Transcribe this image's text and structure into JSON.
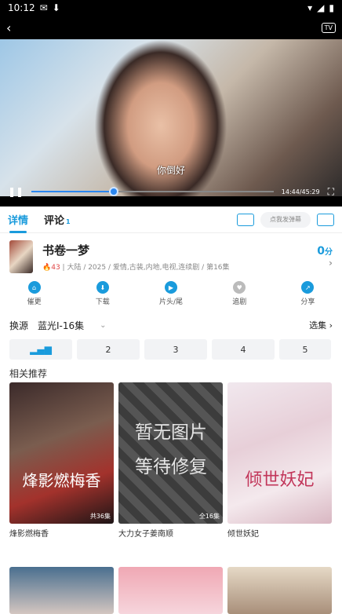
{
  "statusbar": {
    "time": "10:12"
  },
  "player": {
    "subtitle": "你倒好",
    "time_display": "14:44/45:29",
    "progress": 0.34
  },
  "tabs": [
    {
      "label": "详情"
    },
    {
      "label": "评论",
      "count": "1"
    }
  ],
  "danmu": {
    "placeholder": "点我发弹幕"
  },
  "info": {
    "title": "书卷一梦",
    "heat": "43",
    "meta": "大陆 / 2025 / 爱情,古装,内地,电视,连续剧 / 第16集",
    "score": "0",
    "score_unit": "分"
  },
  "actions": [
    {
      "label": "催更",
      "icon": "home-icon"
    },
    {
      "label": "下载",
      "icon": "download-icon"
    },
    {
      "label": "片头/尾",
      "icon": "play-icon"
    },
    {
      "label": "追剧",
      "icon": "heart-icon"
    },
    {
      "label": "分享",
      "icon": "share-icon"
    }
  ],
  "source": {
    "label": "换源",
    "value": "蓝光I-16集",
    "more": "选集"
  },
  "episodes": [
    "2",
    "3",
    "4",
    "5"
  ],
  "related": {
    "title": "相关推荐",
    "items": [
      {
        "name": "烽影燃梅香",
        "tag": "共36集",
        "cover_text": "烽影燃梅香"
      },
      {
        "name": "大力女子姜南顺",
        "tag": "全16集",
        "cover_text": "暂无图片 等待修复"
      },
      {
        "name": "倾世妖妃",
        "tag": "",
        "cover_text": "倾世妖妃"
      }
    ]
  }
}
